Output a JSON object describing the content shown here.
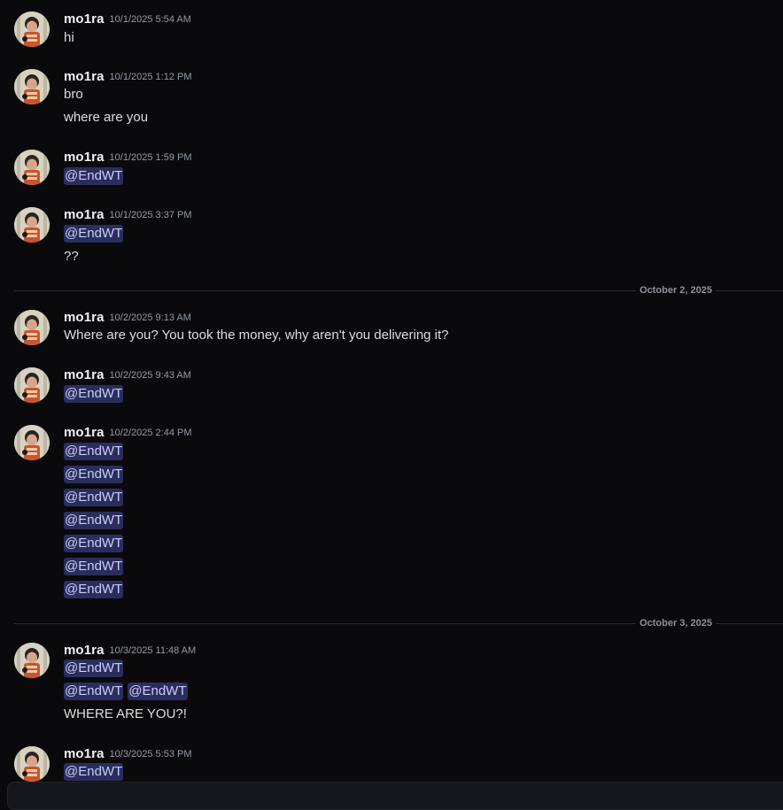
{
  "chat": {
    "username": "mo1ra",
    "mention": "@EndWT",
    "date_dividers": [
      "October 2, 2025",
      "October 3, 2025"
    ],
    "messages": [
      {
        "timestamp": "10/1/2025 5:54 AM",
        "lines": [
          [
            "hi"
          ]
        ]
      },
      {
        "timestamp": "10/1/2025 1:12 PM",
        "lines": [
          [
            "bro"
          ],
          [
            "where are you"
          ]
        ]
      },
      {
        "timestamp": "10/1/2025 1:59 PM",
        "lines": [
          [
            "@EndWT"
          ]
        ]
      },
      {
        "timestamp": "10/1/2025 3:37 PM",
        "lines": [
          [
            "@EndWT"
          ],
          [
            "??"
          ]
        ]
      },
      {
        "timestamp": "10/2/2025 9:13 AM",
        "lines": [
          [
            "Where are you? You took the money, why aren't you delivering it?"
          ]
        ]
      },
      {
        "timestamp": "10/2/2025 9:43 AM",
        "lines": [
          [
            "@EndWT"
          ]
        ]
      },
      {
        "timestamp": "10/2/2025 2:44 PM",
        "lines": [
          [
            "@EndWT"
          ],
          [
            "@EndWT"
          ],
          [
            "@EndWT"
          ],
          [
            "@EndWT"
          ],
          [
            "@EndWT"
          ],
          [
            "@EndWT"
          ],
          [
            "@EndWT"
          ]
        ]
      },
      {
        "timestamp": "10/3/2025 11:48 AM",
        "lines": [
          [
            "@EndWT"
          ],
          [
            "@EndWT",
            "@EndWT"
          ],
          [
            "WHERE ARE YOU?!"
          ]
        ]
      },
      {
        "timestamp": "10/3/2025 5:53 PM",
        "lines": [
          [
            "@EndWT"
          ]
        ]
      }
    ]
  },
  "colors": {
    "background": "#0a0a0c",
    "mention_bg": "#2b2d5c",
    "mention_text": "#c9cdfb",
    "text": "#dbdee1",
    "timestamp": "#949ba4"
  }
}
